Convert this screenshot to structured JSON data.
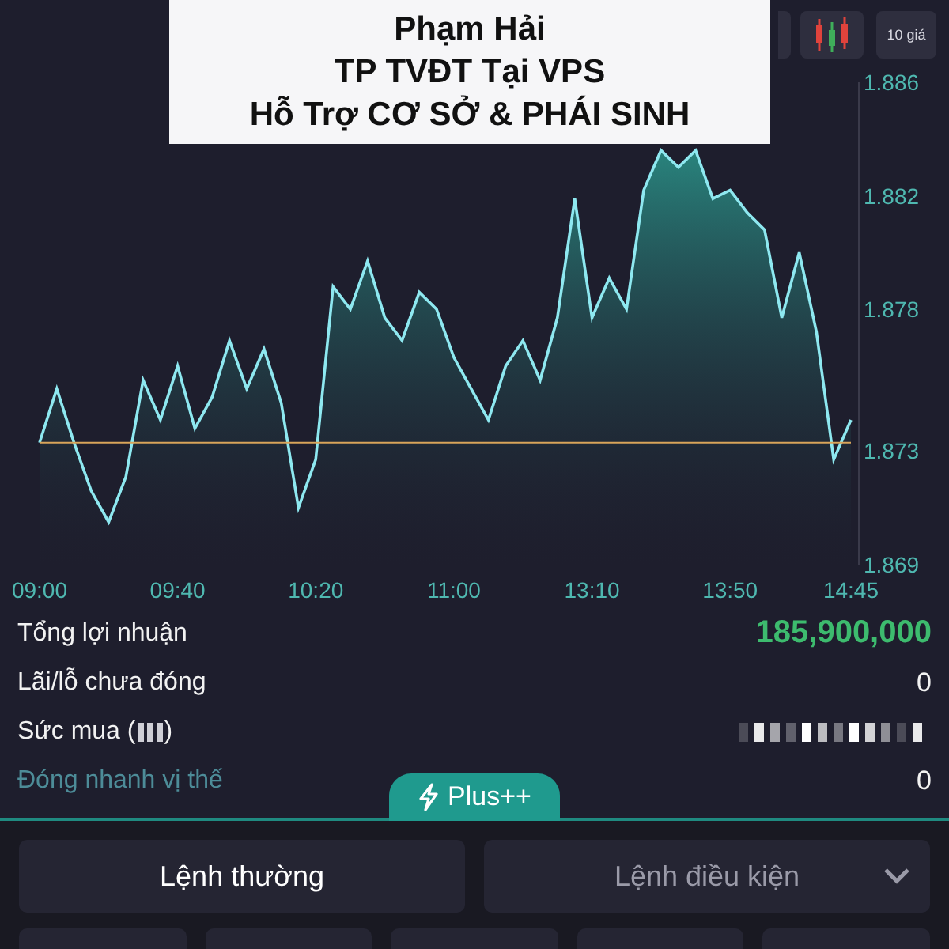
{
  "caption": {
    "lines": [
      "Phạm Hải",
      "TP TVĐT Tại VPS",
      "Hỗ Trợ CƠ SỞ & PHÁI SINH"
    ]
  },
  "toolbar": {
    "price_levels_button": "10 giá"
  },
  "chart": {
    "chart_data": {
      "type": "area",
      "categories": [
        "09:00",
        null,
        null,
        null,
        null,
        null,
        null,
        null,
        "09:40",
        null,
        null,
        null,
        null,
        null,
        null,
        null,
        "10:20",
        null,
        null,
        null,
        null,
        null,
        null,
        null,
        "11:00",
        null,
        null,
        null,
        null,
        null,
        null,
        null,
        "13:10",
        null,
        null,
        null,
        null,
        null,
        null,
        null,
        "13:50",
        null,
        null,
        null,
        null,
        null,
        null,
        "14:45"
      ],
      "series": [
        {
          "color": "#8ee8f0",
          "values": [
            1.8733,
            1.8752,
            1.8733,
            1.8716,
            1.8705,
            1.8721,
            1.8755,
            1.8741,
            1.876,
            1.8738,
            1.8749,
            1.8769,
            1.8752,
            1.8766,
            1.8747,
            1.871,
            1.8727,
            1.8788,
            1.878,
            1.8797,
            1.8777,
            1.8769,
            1.8786,
            1.878,
            1.8763,
            1.8752,
            1.8741,
            1.876,
            1.8769,
            1.8755,
            1.8777,
            1.8819,
            1.8777,
            1.8791,
            1.878,
            1.8822,
            1.8836,
            1.883,
            1.8836,
            1.8819,
            1.8822,
            1.8814,
            1.8808,
            1.8777,
            1.88,
            1.8772,
            1.8727,
            1.8741
          ]
        },
        {
          "type": "line",
          "color": "#d9a55a",
          "values": [
            1.8733,
            1.8733,
            1.8733,
            1.8733,
            1.8733,
            1.8733,
            1.8733,
            1.8733,
            1.8733,
            1.8733,
            1.8733,
            1.8733,
            1.8733,
            1.8733,
            1.8733,
            1.8733,
            1.8733,
            1.8733,
            1.8733,
            1.8733,
            1.8733,
            1.8733,
            1.8733,
            1.8733,
            1.8733,
            1.8733,
            1.8733,
            1.8733,
            1.8733,
            1.8733,
            1.8733,
            1.8733,
            1.8733,
            1.8733,
            1.8733,
            1.8733,
            1.8733,
            1.8733,
            1.8733,
            1.8733,
            1.8733,
            1.8733,
            1.8733,
            1.8733,
            1.8733,
            1.8733,
            1.8733,
            1.8733
          ]
        }
      ],
      "ylim": [
        1.869,
        1.886
      ],
      "yticks": [
        1.886,
        1.882,
        1.878,
        1.873,
        1.869
      ]
    }
  },
  "summary": [
    {
      "kind": "value",
      "label": "Tổng lợi nhuận",
      "value": "185,900,000",
      "highlight": true
    },
    {
      "kind": "value",
      "label": "Lãi/lỗ chưa đóng",
      "value": "0",
      "highlight": false
    },
    {
      "kind": "redacted",
      "label": "Sức mua (",
      "label_end": ")"
    },
    {
      "kind": "link",
      "label": "Đóng nhanh vị thế",
      "value": "0",
      "highlight": false
    }
  ],
  "plus_tab": {
    "label": "Plus++"
  },
  "order_types": [
    {
      "label": "Lệnh thường",
      "selected": true,
      "dropdown": false
    },
    {
      "label": "Lệnh điều kiện",
      "selected": false,
      "dropdown": true
    }
  ]
}
